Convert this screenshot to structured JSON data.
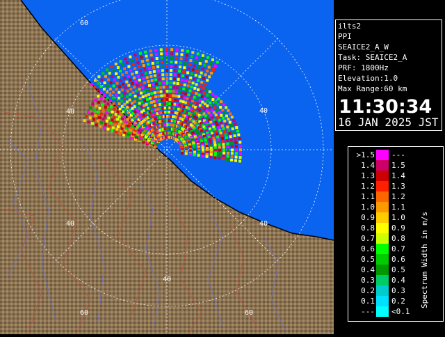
{
  "info": {
    "site": "ilts2",
    "mode": "PPI",
    "scan_name": "SEAICE2_A_W",
    "task": "Task: SEAICE2_A",
    "prf": "PRF: 1800Hz",
    "elevation": "Elevation:1.0",
    "max_range": "Max Range:60 km",
    "time": "11:30:34",
    "date": "16 JAN 2025 JST"
  },
  "legend": {
    "title": "Spectrum Width in m/s",
    "rows": [
      {
        "left": ">1.5",
        "right": "---",
        "color": "#ff00ff"
      },
      {
        "left": "1.4",
        "right": "1.5",
        "color": "#cc0066"
      },
      {
        "left": "1.3",
        "right": "1.4",
        "color": "#cc0000"
      },
      {
        "left": "1.2",
        "right": "1.3",
        "color": "#ff2000"
      },
      {
        "left": "1.1",
        "right": "1.2",
        "color": "#ff6600"
      },
      {
        "left": "1.0",
        "right": "1.1",
        "color": "#ff9900"
      },
      {
        "left": "0.9",
        "right": "1.0",
        "color": "#ffcc00"
      },
      {
        "left": "0.8",
        "right": "0.9",
        "color": "#ffff00"
      },
      {
        "left": "0.7",
        "right": "0.8",
        "color": "#ccff00"
      },
      {
        "left": "0.6",
        "right": "0.7",
        "color": "#00ff00"
      },
      {
        "left": "0.5",
        "right": "0.6",
        "color": "#00cc00"
      },
      {
        "left": "0.4",
        "right": "0.5",
        "color": "#009900"
      },
      {
        "left": "0.3",
        "right": "0.4",
        "color": "#00cc66"
      },
      {
        "left": "0.2",
        "right": "0.3",
        "color": "#00cccc"
      },
      {
        "left": "0.1",
        "right": "0.2",
        "color": "#00e0ff"
      },
      {
        "left": "---",
        "right": "<0.1",
        "color": "#00ffff"
      }
    ]
  },
  "map": {
    "sea_color": "#0a64f0",
    "land_color": "#8c7352",
    "range_labels": [
      "40",
      "40",
      "40",
      "40",
      "40",
      "60",
      "60",
      "60"
    ]
  }
}
